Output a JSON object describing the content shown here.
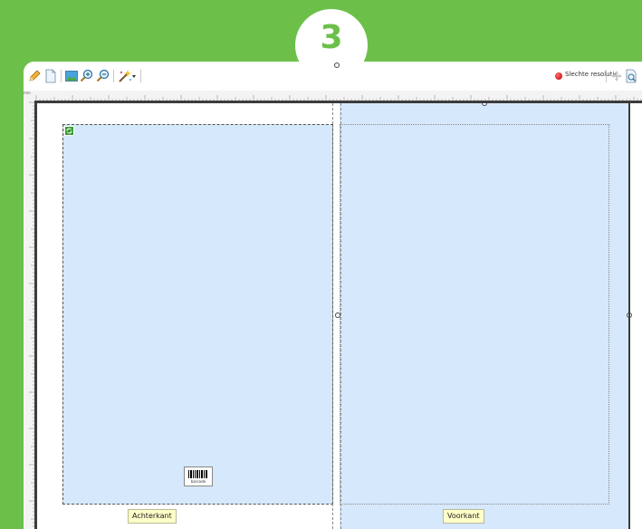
{
  "step": {
    "number": "3"
  },
  "toolbar": {
    "buttons": [
      {
        "name": "pencil-icon"
      },
      {
        "name": "page-icon"
      },
      {
        "name": "picture-icon"
      },
      {
        "name": "zoom-in-icon"
      },
      {
        "name": "zoom-out-icon"
      },
      {
        "name": "magic-wand-icon"
      },
      {
        "name": "dropdown-arrow-icon"
      }
    ],
    "resolution_status": "Slechte resolutie",
    "resolution_color": "#d00000",
    "right_buttons": [
      {
        "name": "move-icon"
      },
      {
        "name": "preview-icon"
      }
    ]
  },
  "ruler": {
    "unit_label": "mm"
  },
  "pages": {
    "back_label": "Achterkant",
    "front_label": "Voorkant"
  },
  "barcode": {
    "label": "barcode"
  },
  "colors": {
    "background": "#6cc04a",
    "page_fill": "#d6e8fb",
    "label_fill": "#ffffc8",
    "step_number": "#6cc04a"
  }
}
